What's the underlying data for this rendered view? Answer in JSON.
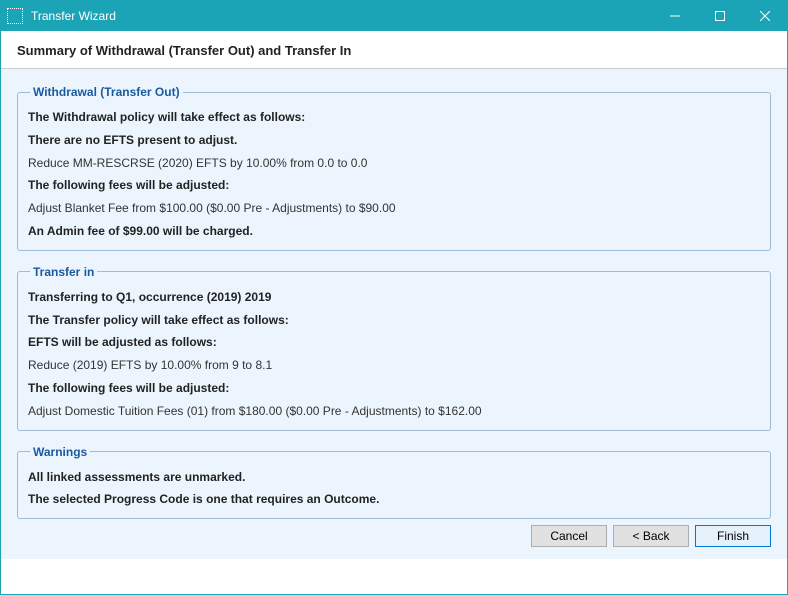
{
  "window": {
    "title": "Transfer Wizard"
  },
  "header": {
    "title": "Summary of Withdrawal (Transfer Out) and Transfer In"
  },
  "groups": {
    "withdrawal": {
      "legend": "Withdrawal (Transfer Out)",
      "line1": "The Withdrawal policy will take effect as follows:",
      "line2": "There are no EFTS present to adjust.",
      "line3": "Reduce MM-RESCRSE (2020) EFTS by 10.00% from 0.0 to 0.0",
      "line4": "The following fees will be adjusted:",
      "line5": "Adjust Blanket Fee from $100.00 ($0.00 Pre - Adjustments) to $90.00",
      "line6": "An Admin fee of $99.00 will be charged."
    },
    "transfer_in": {
      "legend": "Transfer in",
      "line1": "Transferring to Q1, occurrence (2019) 2019",
      "line2": "The Transfer policy will take effect as follows:",
      "line3": "EFTS will be adjusted as follows:",
      "line4": "Reduce  (2019) EFTS by 10.00% from 9 to 8.1",
      "line5": "The following fees will be adjusted:",
      "line6": "Adjust Domestic Tuition Fees (01) from $180.00 ($0.00 Pre - Adjustments) to $162.00"
    },
    "warnings": {
      "legend": "Warnings",
      "line1": "All linked assessments are unmarked.",
      "line2": "The selected Progress Code is one that requires an Outcome."
    }
  },
  "buttons": {
    "cancel": "Cancel",
    "back": "< Back",
    "finish": "Finish"
  }
}
